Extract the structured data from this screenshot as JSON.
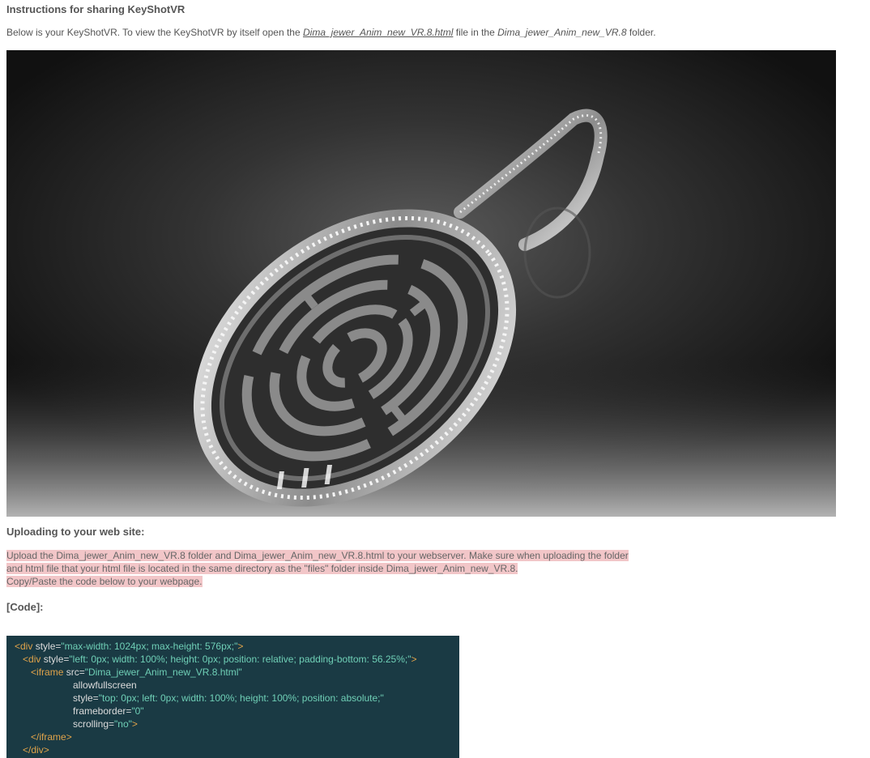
{
  "instructions": {
    "heading": "Instructions for sharing KeyShotVR",
    "intro_prefix": "Below is your KeyShotVR. To view the KeyShotVR by itself open the ",
    "html_link": "Dima_jewer_Anim_new_VR.8.html",
    "intro_middle": " file in the ",
    "folder_name": "Dima_jewer_Anim_new_VR.8",
    "intro_suffix": " folder."
  },
  "upload": {
    "heading": "Uploading to your web site:",
    "line1": "Upload the Dima_jewer_Anim_new_VR.8 folder and Dima_jewer_Anim_new_VR.8.html to your webserver. Make sure when uploading the folder",
    "line2": "and html file that your html file is located in the same directory as the \"files\" folder inside Dima_jewer_Anim_new_VR.8.",
    "line3": "Copy/Paste the code below to your webpage."
  },
  "code": {
    "heading": "[Code]:",
    "l1_tag": "<div",
    "l1_attr": " style=",
    "l1_val": "\"max-width: 1024px; max-height: 576px;\"",
    "l1_end": ">",
    "l2_tag": "<div",
    "l2_attr": " style=",
    "l2_val": "\"left: 0px; width: 100%; height: 0px; position: relative; padding-bottom: 56.25%;\"",
    "l2_end": ">",
    "l3_tag": "<iframe",
    "l3_attr": " src=",
    "l3_val": "\"Dima_jewer_Anim_new_VR.8.html\"",
    "l4": "allowfullscreen",
    "l5_attr": "style=",
    "l5_val": "\"top: 0px; left: 0px; width: 100%; height: 100%; position: absolute;\"",
    "l6_attr": "frameborder=",
    "l6_val": "\"0\"",
    "l7_attr": "scrolling=",
    "l7_val": "\"no\"",
    "l7_end": ">",
    "l8_tag": "</iframe>",
    "l9_tag": "</div>"
  }
}
